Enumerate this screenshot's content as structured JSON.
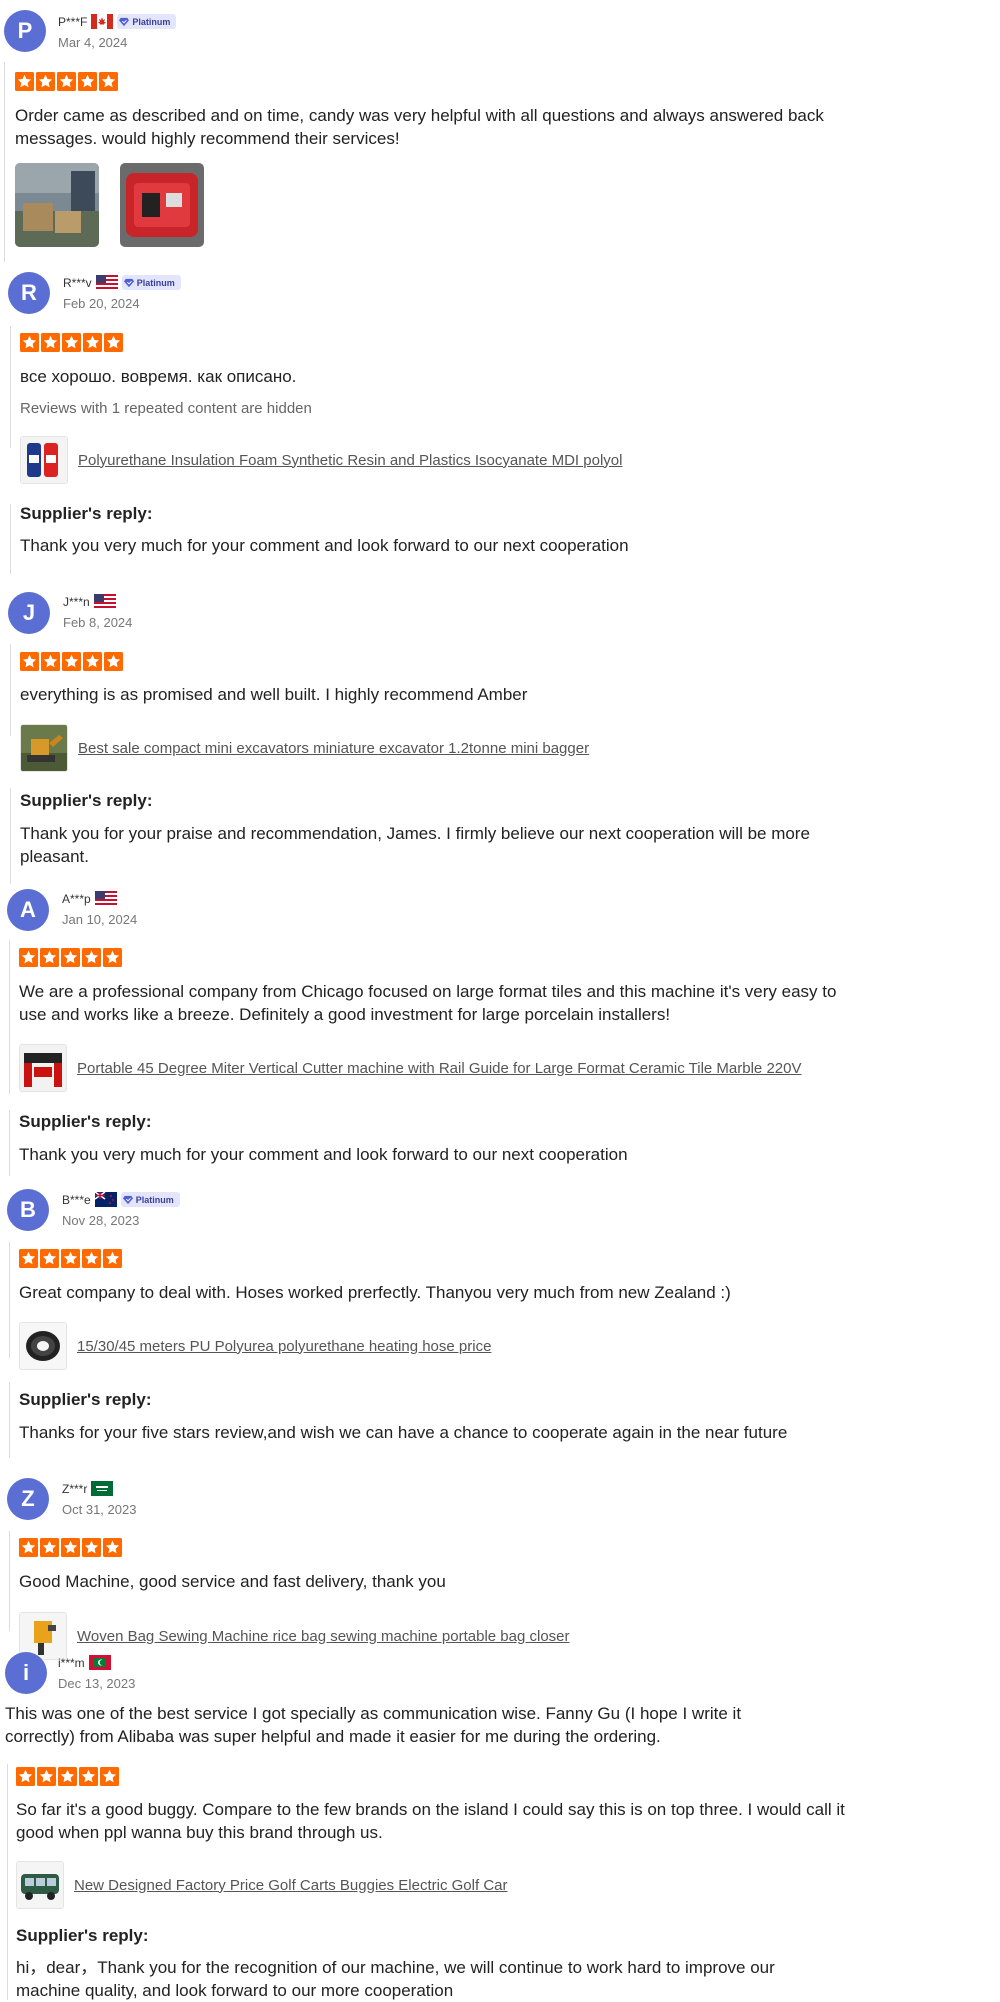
{
  "colors": {
    "avatar": "#5a6ed3",
    "star": "#ff6a00",
    "link": "#555555"
  },
  "reviews": [
    {
      "initial": "P",
      "name": "P***F",
      "country": "CA",
      "badge": "Platinum",
      "date": "Mar 4, 2024",
      "rating": 5,
      "text": "Order came as described and on time, candy was very helpful with all questions and always answered back messages. would highly recommend their services!",
      "photos": [
        "photo-boxes",
        "photo-red-case"
      ]
    },
    {
      "initial": "R",
      "name": "R***v",
      "country": "US",
      "badge": "Platinum",
      "date": "Feb 20, 2024",
      "rating": 5,
      "text": "все хорошо. вовремя. как описано.",
      "hidden_note": "Reviews with 1 repeated content are hidden",
      "product": "Polyurethane Insulation Foam Synthetic Resin and Plastics Isocyanate MDI polyol",
      "reply_title": "Supplier's reply:",
      "reply": "Thank you very much for your comment and look forward to our next cooperation"
    },
    {
      "initial": "J",
      "name": "J***n",
      "country": "US",
      "date": "Feb 8, 2024",
      "rating": 5,
      "text": "everything is as promised and well built. I highly recommend Amber",
      "product": "Best sale compact mini excavators miniature excavator 1.2tonne mini bagger",
      "reply_title": "Supplier's reply:",
      "reply": "Thank you for your praise and recommendation, James. I firmly believe our next cooperation will be more pleasant."
    },
    {
      "initial": "A",
      "name": "A***p",
      "country": "US",
      "date": "Jan 10, 2024",
      "rating": 5,
      "text": "We are a professional company from Chicago focused on large format tiles and this machine it's very easy to use and works like a breeze. Definitely a good investment for large porcelain installers!",
      "product": "Portable 45 Degree Miter Vertical Cutter machine with Rail Guide for Large Format Ceramic Tile Marble 220V",
      "reply_title": "Supplier's reply:",
      "reply": "Thank you very much for your comment and look forward to our next cooperation"
    },
    {
      "initial": "B",
      "name": "B***e",
      "country": "NZ",
      "badge": "Platinum",
      "date": "Nov 28, 2023",
      "rating": 5,
      "text": "Great company to deal with. Hoses worked prerfectly. Thanyou very much from new Zealand :)",
      "product": "15/30/45 meters PU Polyurea polyurethane heating hose price",
      "reply_title": "Supplier's reply:",
      "reply": "Thanks for your five stars review,and wish we can have a chance to cooperate again in the near future"
    },
    {
      "initial": "Z",
      "name": "Z***r",
      "country": "SA",
      "date": "Oct 31, 2023",
      "rating": 5,
      "text": "Good Machine, good service and fast delivery, thank you",
      "product": "Woven Bag Sewing Machine rice bag sewing machine portable bag closer"
    },
    {
      "initial": "i",
      "name": "i***m",
      "country": "MV",
      "date": "Dec 13, 2023",
      "text_top": "This was one of the best service I got specially as communication wise. Fanny Gu (I hope I write it correctly) from Alibaba was super helpful and made it easier for me during the ordering.",
      "rating": 5,
      "text": "So far it's a good buggy. Compare to the few brands on the island I could say this is on top three. I would call it good when ppl wanna buy this brand through us.",
      "product": "New Designed Factory Price Golf Carts Buggies Electric Golf Car",
      "reply_title": "Supplier's reply:",
      "reply": "hi，dear，Thank you for the recognition of our machine, we will continue to work hard to improve our machine quality, and look forward to our more cooperation"
    }
  ]
}
